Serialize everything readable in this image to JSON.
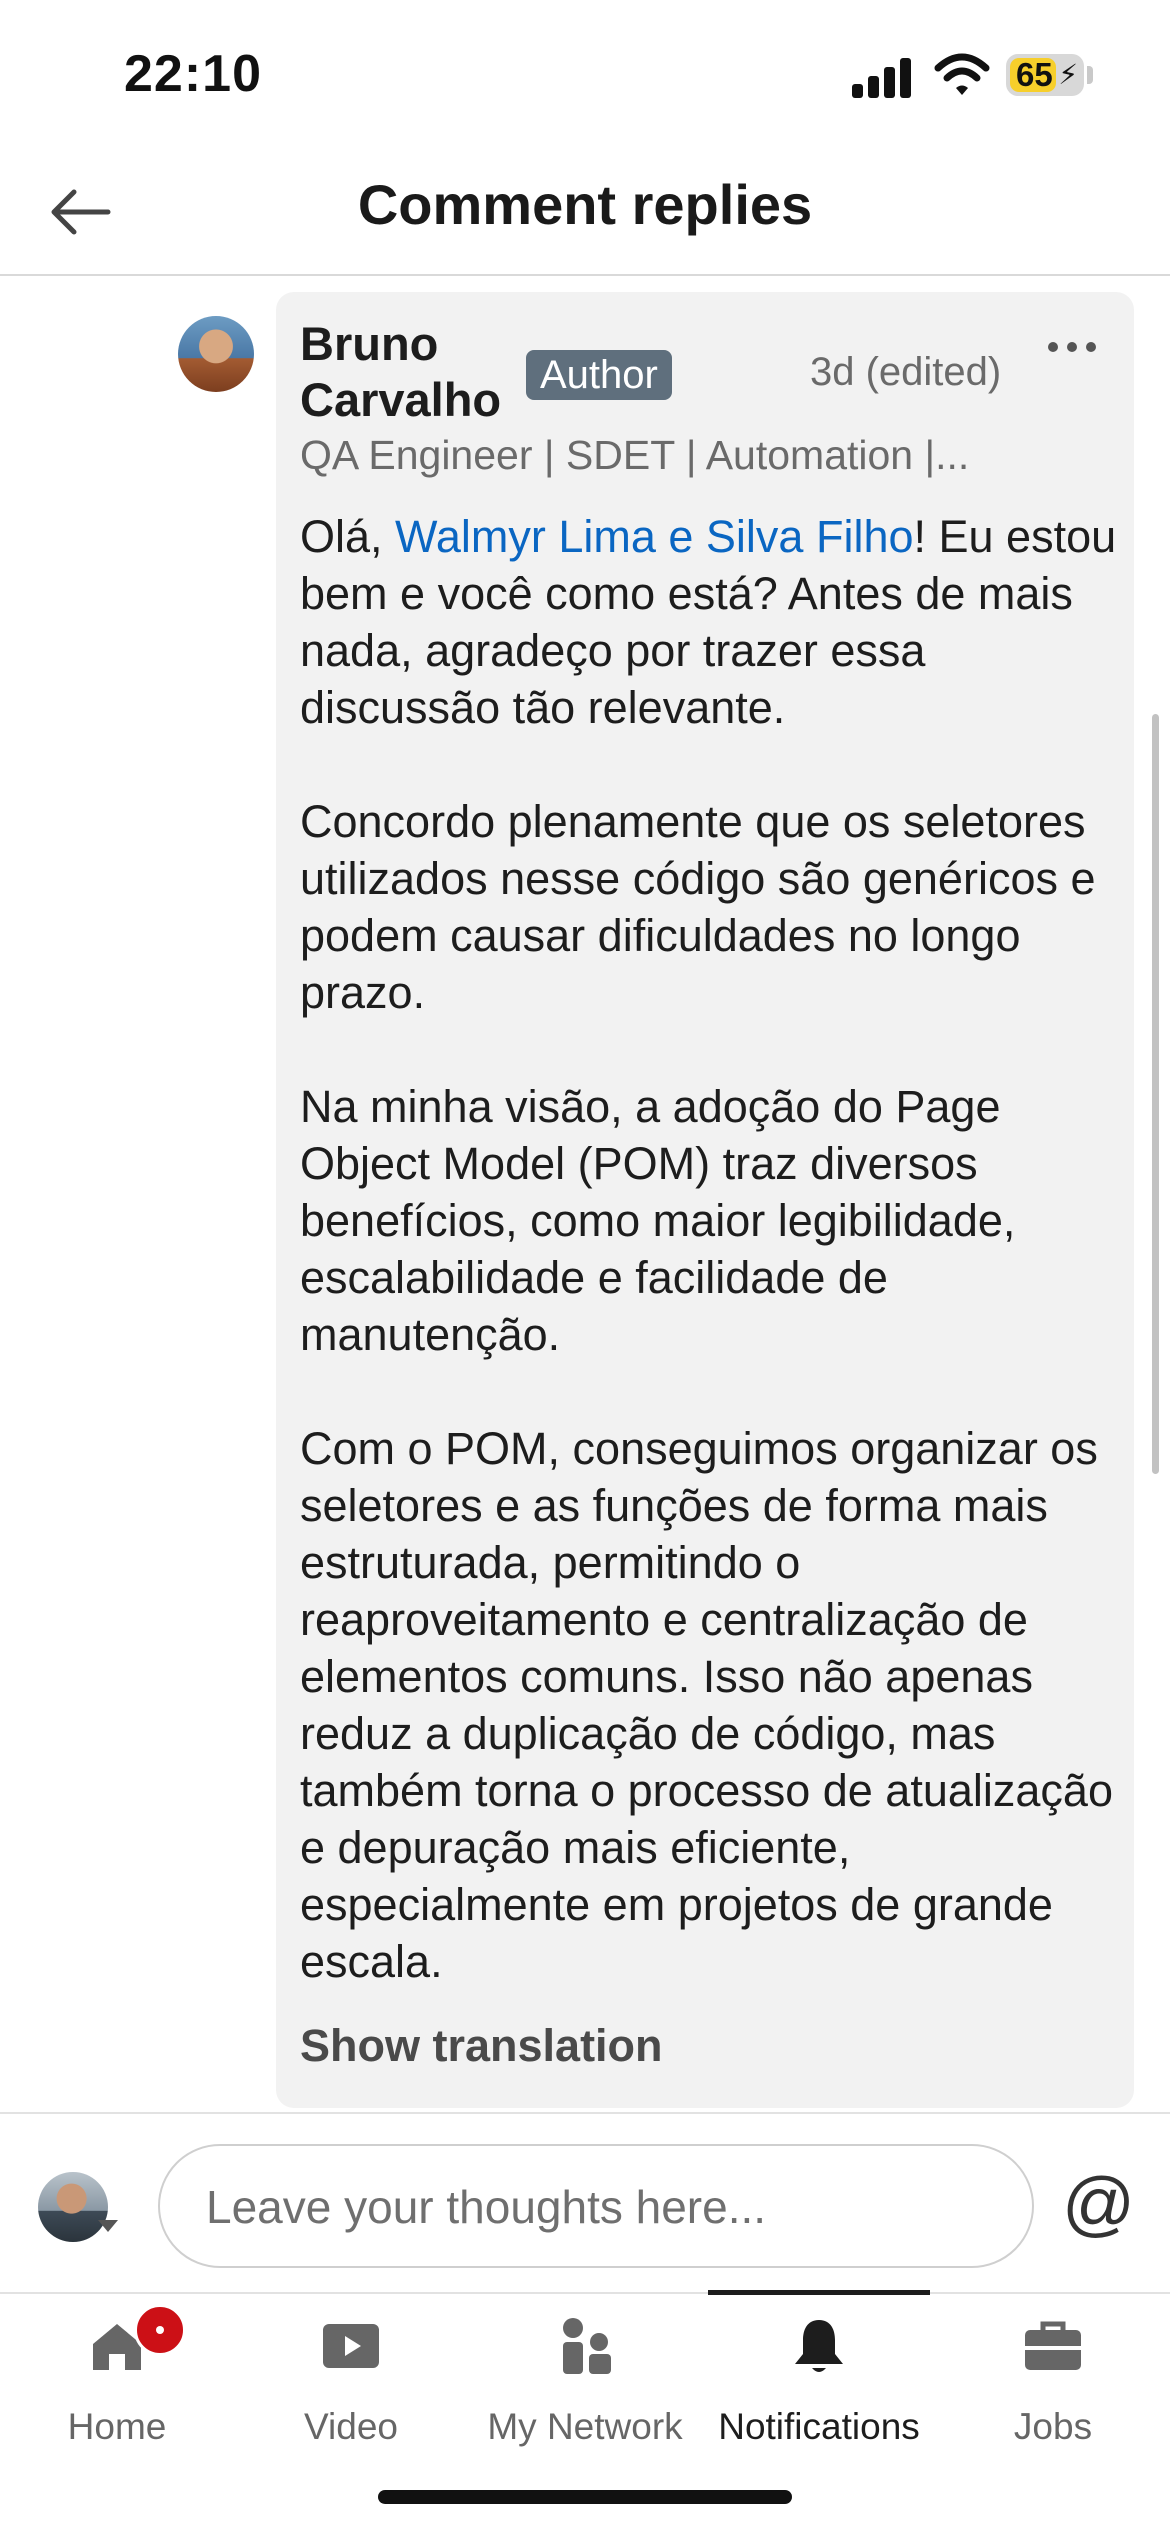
{
  "status_bar": {
    "time": "22:10",
    "battery_percent": "65",
    "battery_level": 0.65,
    "charging": true
  },
  "header": {
    "title": "Comment replies",
    "back_icon": "arrow-left-icon"
  },
  "comment": {
    "author_name": "Bruno Carvalho",
    "author_badge": "Author",
    "timestamp": "3d (edited)",
    "headline": "QA Engineer | SDET | Automation |...",
    "more_icon": "ellipsis-icon",
    "greeting_prefix": "Olá, ",
    "mention": "Walmyr Lima e Silva Filho",
    "greeting_rest": "! Eu estou bem e você como está? Antes de mais nada, agradeço por trazer essa discussão tão relevante.",
    "paragraphs": [
      "Concordo plenamente que os seletores utilizados nesse código são genéricos e podem causar dificuldades no longo prazo.",
      "Na minha visão, a adoção do Page Object Model (POM) traz diversos benefícios, como maior legibilidade, escalabilidade e facilidade de manutenção.",
      "Com o POM, conseguimos organizar os seletores e as funções de forma mais estruturada, permitindo o reaproveitamento e centralização de elementos comuns. Isso não apenas reduz a duplicação de código, mas também torna o processo de atualização e depuração mais eficiente, especialmente em projetos de grande escala."
    ],
    "show_translation": "Show translation"
  },
  "composer": {
    "placeholder": "Leave your thoughts here...",
    "mention_symbol": "@"
  },
  "bottom_nav": {
    "items": [
      {
        "label": "Home",
        "icon": "home-icon",
        "has_badge": true
      },
      {
        "label": "Video",
        "icon": "video-play-icon"
      },
      {
        "label": "My Network",
        "icon": "people-icon"
      },
      {
        "label": "Notifications",
        "icon": "bell-icon",
        "active": true
      },
      {
        "label": "Jobs",
        "icon": "briefcase-icon"
      }
    ]
  },
  "colors": {
    "mention": "#0a66c2",
    "badge_bg": "#5f6f7d",
    "notification_badge": "#cc1016",
    "bubble_bg": "#f2f2f2",
    "battery_fill": "#f7cf2b"
  }
}
